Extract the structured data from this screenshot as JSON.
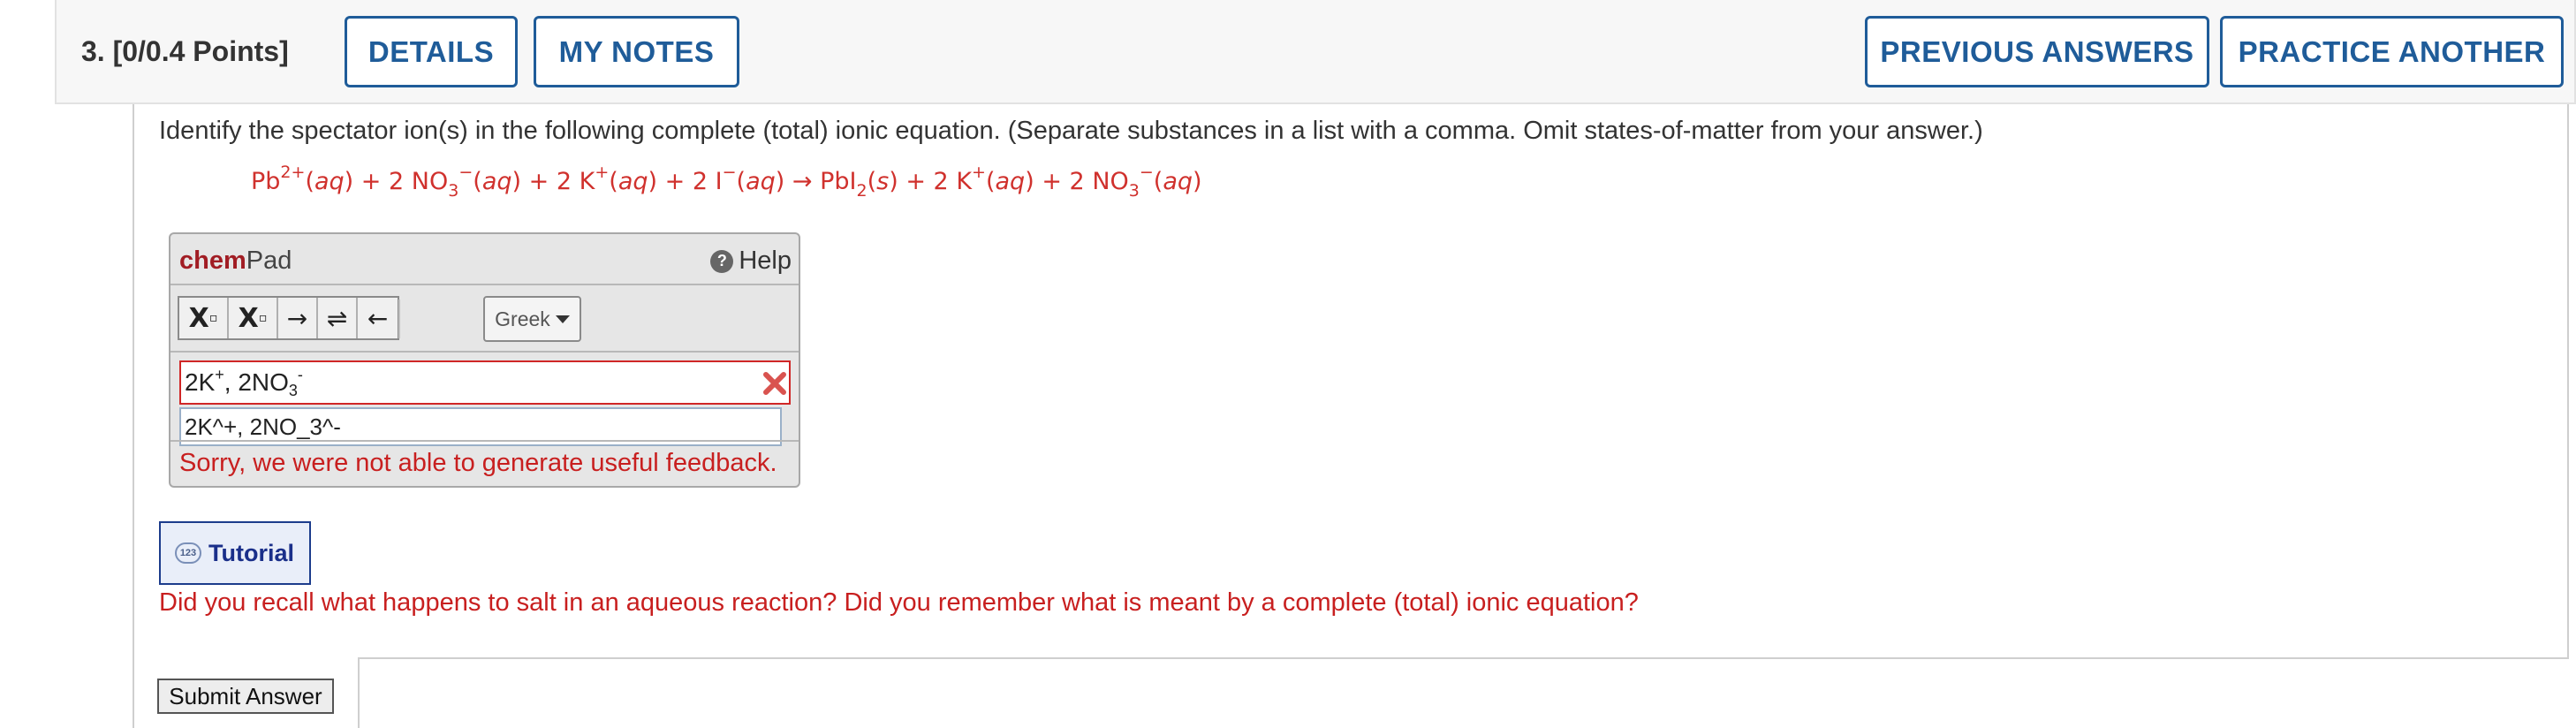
{
  "header": {
    "question_label": "3.  [0/0.4 Points]",
    "buttons": {
      "details": "DETAILS",
      "my_notes": "MY NOTES",
      "previous_answers": "PREVIOUS ANSWERS",
      "practice_another": "PRACTICE ANOTHER"
    }
  },
  "question": {
    "prompt": "Identify the spectator ion(s) in the following complete (total) ionic equation. (Separate substances in a list with a comma. Omit states-of-matter from your answer.)",
    "equation": {
      "pb": "Pb",
      "pb_charge": "2+",
      "aq": "aq",
      "plus": "+",
      "two": "2",
      "no": "NO",
      "three": "3",
      "minus": "−",
      "k": "K",
      "kplus": "+",
      "i": "I",
      "arrow": "→",
      "pbi": "PbI",
      "sub2": "2",
      "s": "s"
    }
  },
  "chempad": {
    "brand_bold": "chem",
    "brand_rest": "Pad",
    "help_label": "Help",
    "greek_label": "Greek",
    "tools": {
      "subscript": "X",
      "superscript": "X",
      "arrow_right": "→",
      "equilibrium": "⇌",
      "arrow_left": "←"
    },
    "answer_rendered": {
      "part1": "2K",
      "sup1": "+",
      "part2": ", 2NO",
      "sub": "3",
      "sup2": "-"
    },
    "raw_input_value": "2K^+, 2NO_3^-",
    "feedback": "Sorry, we were not able to generate useful feedback.",
    "status_icon": "x-icon",
    "colors": {
      "error": "#c81f1f",
      "brand": "#a11d24"
    }
  },
  "tutorial": {
    "icon": "calculator-bubble-icon",
    "icon_text": "123",
    "label": "Tutorial"
  },
  "hint": "Did you recall what happens to salt in an aqueous reaction? Did you remember what is meant by a complete (total) ionic equation?",
  "submit_label": "Submit Answer",
  "colors": {
    "accent": "#1f5c99",
    "error_red": "#d0312d"
  }
}
